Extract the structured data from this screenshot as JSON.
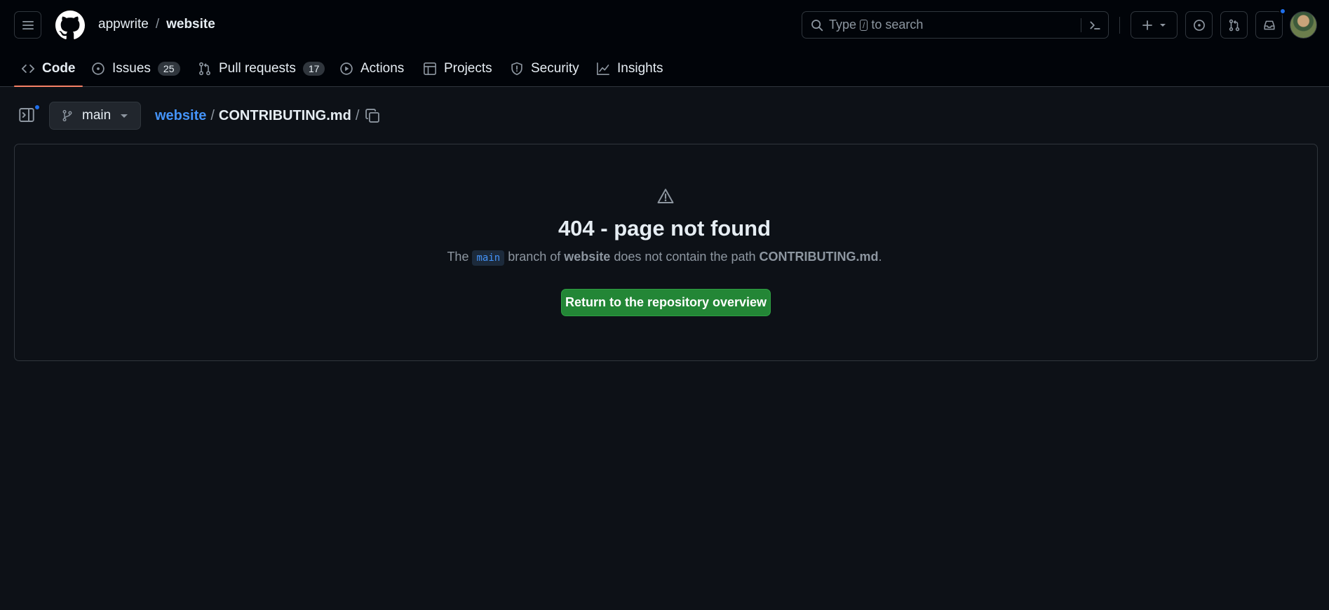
{
  "header": {
    "owner": "appwrite",
    "separator": "/",
    "repo": "website",
    "search_prefix": "Type",
    "search_key": "/",
    "search_suffix": "to search"
  },
  "tabs": [
    {
      "label": "Code",
      "icon": "code-icon",
      "active": true
    },
    {
      "label": "Issues",
      "icon": "issue-icon",
      "count": "25"
    },
    {
      "label": "Pull requests",
      "icon": "pull-request-icon",
      "count": "17"
    },
    {
      "label": "Actions",
      "icon": "play-icon"
    },
    {
      "label": "Projects",
      "icon": "table-icon"
    },
    {
      "label": "Security",
      "icon": "shield-icon"
    },
    {
      "label": "Insights",
      "icon": "graph-icon"
    }
  ],
  "breadcrumb": {
    "branch": "main",
    "root": "website",
    "sep": "/",
    "file": "CONTRIBUTING.md",
    "trailing": "/"
  },
  "error": {
    "title": "404 - page not found",
    "desc_the": "The",
    "desc_branch": "main",
    "desc_mid": "branch of",
    "desc_repo": "website",
    "desc_path_text": "does not contain the path",
    "desc_path": "CONTRIBUTING.md",
    "desc_end": ".",
    "button": "Return to the repository overview"
  },
  "colors": {
    "accent_link": "#4493f8",
    "primary_button": "#238636",
    "active_tab_underline": "#f78166",
    "notification_dot": "#1f6feb"
  }
}
